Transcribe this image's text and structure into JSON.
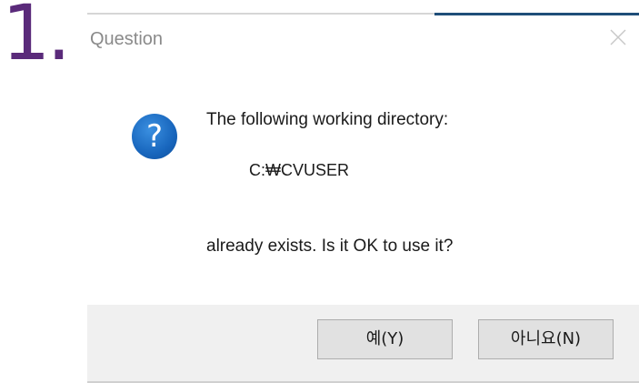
{
  "step": {
    "number": "1."
  },
  "dialog": {
    "title": "Question",
    "icon": "question-icon",
    "message_line1": "The following working directory:",
    "path": "C:₩CVUSER",
    "message_line2": "already exists.  Is it OK to use it?",
    "buttons": {
      "yes_label": "예(Y)",
      "no_label": "아니요(N)"
    }
  },
  "colors": {
    "step_number": "#5a2a7a",
    "icon_blue": "#1866bd",
    "button_bar": "#f0f0f0",
    "title_text": "#8a8a8a",
    "accent": "#1f4e79"
  }
}
